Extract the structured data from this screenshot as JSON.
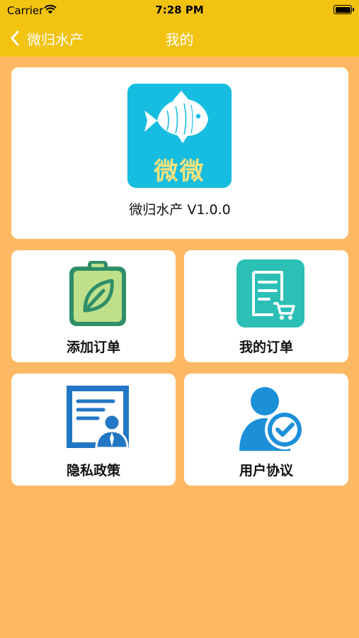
{
  "status_bar": {
    "carrier": "Carrier",
    "time": "7:28 PM"
  },
  "nav": {
    "back_label": "微归水产",
    "title": "我的"
  },
  "app": {
    "icon_text": "微微",
    "name_version": "微归水产 V1.0.0"
  },
  "menu": [
    {
      "label": "添加订单",
      "icon": "clipboard-leaf-icon"
    },
    {
      "label": "我的订单",
      "icon": "order-list-cart-icon"
    },
    {
      "label": "隐私政策",
      "icon": "privacy-document-person-icon"
    },
    {
      "label": "用户协议",
      "icon": "user-check-icon"
    }
  ],
  "colors": {
    "nav_bar": "#F2C311",
    "background": "#FDB863",
    "app_icon_bg": "#17BDE0",
    "icon_text": "#F8E37C"
  }
}
